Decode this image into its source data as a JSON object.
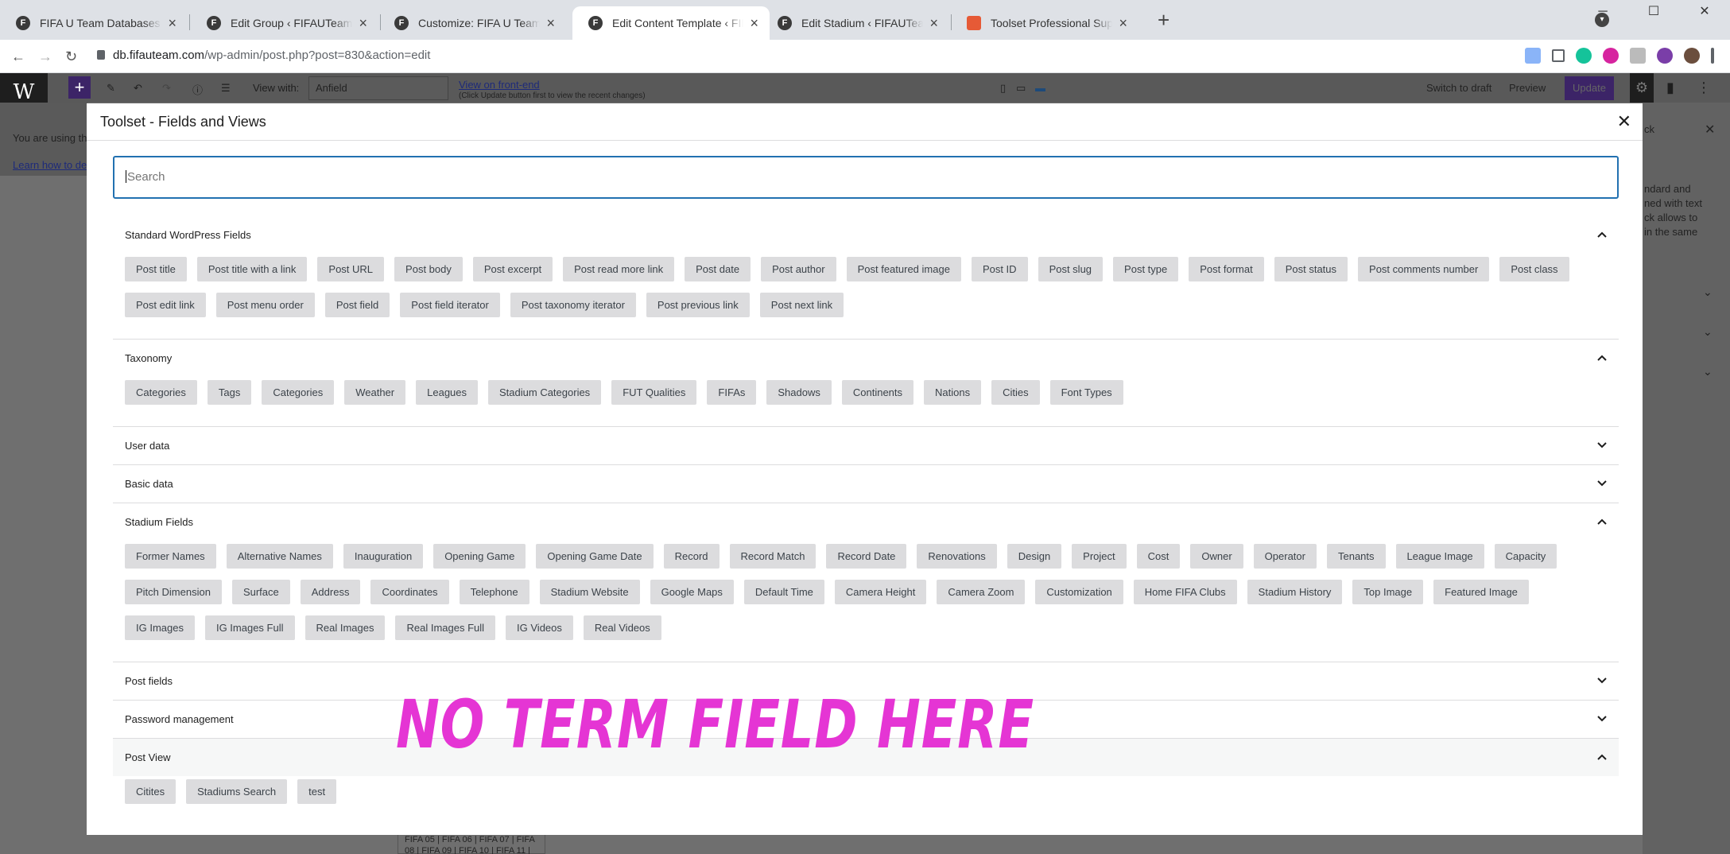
{
  "browser": {
    "tabs": [
      {
        "title": "FIFA U Team Databases - Everything",
        "icon": "site-favicon",
        "active": false
      },
      {
        "title": "Edit Group ‹ FIFAUTeam Databases",
        "icon": "site-favicon",
        "active": false
      },
      {
        "title": "Customize: FIFA U Team Databases",
        "icon": "site-favicon",
        "active": false
      },
      {
        "title": "Edit Content Template ‹ FIFAUTeam",
        "icon": "site-favicon",
        "active": true
      },
      {
        "title": "Edit Stadium ‹ FIFAUTeam Databases",
        "icon": "site-favicon",
        "active": false
      },
      {
        "title": "Toolset Professional Support - Toolset",
        "icon": "toolset-favicon",
        "active": false
      }
    ],
    "url_host": "db.fifauteam.com",
    "url_path": "/wp-admin/post.php?post=830&action=edit"
  },
  "editor": {
    "view_with_label": "View with:",
    "view_with_value": "Anfield",
    "view_front_end": "View on front-end",
    "view_front_end_note": "(Click Update button first to view the recent changes)",
    "switch_to_draft": "Switch to draft",
    "preview": "Preview",
    "update": "Update",
    "notice_line1": "You are using th",
    "notice_link": "Learn how to de",
    "right_panel_tab": "ck",
    "right_panel_text": [
      "ndard and",
      "ned with text",
      "ck allows to",
      "in the same"
    ]
  },
  "background_snippet": {
    "line1": "FIFA 05 | FIFA 06 | FIFA 07 | FIFA",
    "line2": "08 | FIFA 09 | FIFA 10 | FIFA 11 |"
  },
  "modal": {
    "title": "Toolset - Fields and Views",
    "search_placeholder": "Search",
    "sections": [
      {
        "title": "Standard WordPress Fields",
        "expanded": true,
        "items": [
          "Post title",
          "Post title with a link",
          "Post URL",
          "Post body",
          "Post excerpt",
          "Post read more link",
          "Post date",
          "Post author",
          "Post featured image",
          "Post ID",
          "Post slug",
          "Post type",
          "Post format",
          "Post status",
          "Post comments number",
          "Post class",
          "Post edit link",
          "Post menu order",
          "Post field",
          "Post field iterator",
          "Post taxonomy iterator",
          "Post previous link",
          "Post next link"
        ]
      },
      {
        "title": "Taxonomy",
        "expanded": true,
        "items": [
          "Categories",
          "Tags",
          "Categories",
          "Weather",
          "Leagues",
          "Stadium Categories",
          "FUT Qualities",
          "FIFAs",
          "Shadows",
          "Continents",
          "Nations",
          "Cities",
          "Font Types"
        ]
      },
      {
        "title": "User data",
        "expanded": false,
        "items": []
      },
      {
        "title": "Basic data",
        "expanded": false,
        "items": []
      },
      {
        "title": "Stadium Fields",
        "expanded": true,
        "items": [
          "Former Names",
          "Alternative Names",
          "Inauguration",
          "Opening Game",
          "Opening Game Date",
          "Record",
          "Record Match",
          "Record Date",
          "Renovations",
          "Design",
          "Project",
          "Cost",
          "Owner",
          "Operator",
          "Tenants",
          "League Image",
          "Capacity",
          "Pitch Dimension",
          "Surface",
          "Address",
          "Coordinates",
          "Telephone",
          "Stadium Website",
          "Google Maps",
          "Default Time",
          "Camera Height",
          "Camera Zoom",
          "Customization",
          "Home FIFA Clubs",
          "Stadium History",
          "Top Image",
          "Featured Image",
          "IG Images",
          "IG Images Full",
          "Real Images",
          "Real Images Full",
          "IG Videos",
          "Real Videos"
        ]
      },
      {
        "title": "Post fields",
        "expanded": false,
        "items": []
      },
      {
        "title": "Password management",
        "expanded": false,
        "items": []
      },
      {
        "title": "Post View",
        "expanded": true,
        "items": [
          "Citites",
          "Stadiums Search",
          "test"
        ]
      }
    ]
  },
  "annotation": {
    "text": "NO TERM FIELD HERE",
    "color": "#e535d4"
  },
  "colors": {
    "accent": "#2271b1",
    "wp_purple": "#3c2467",
    "chip_bg": "#dcdcde"
  }
}
